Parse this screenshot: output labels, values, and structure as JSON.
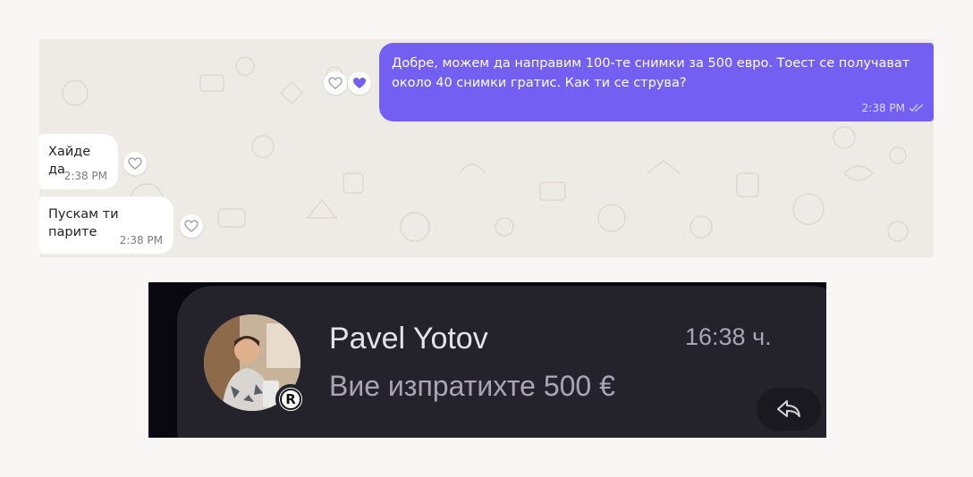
{
  "chat": {
    "outgoing": {
      "text": "Добре, можем да направим 100-те снимки за 500 евро. Тоест се получават около 40 снимки гратис. Как ти се струва?",
      "time": "2:38 PM",
      "status_icon": "double-check-icon",
      "liked": true
    },
    "incoming": [
      {
        "text": "Хайде да",
        "time": "2:38 PM"
      },
      {
        "text": "Пускам ти парите",
        "time": "2:38 PM"
      }
    ],
    "colors": {
      "outgoing_bubble": "#7360f2",
      "background": "#eeebe6"
    }
  },
  "notification": {
    "sender": "Pavel Yotov",
    "time": "16:38 ч.",
    "preview": "Вие изпратихте 500 €",
    "badge_letter": "R",
    "reply_icon": "reply-arrow-icon"
  }
}
